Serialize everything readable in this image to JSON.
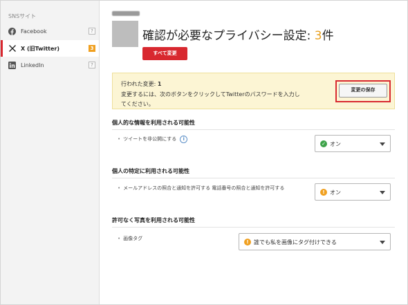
{
  "sidebar": {
    "title": "SNSサイト",
    "items": [
      {
        "label": "Facebook",
        "count": "?"
      },
      {
        "label": "X (旧Twitter)",
        "count": "3"
      },
      {
        "label": "LinkedIn",
        "count": "?"
      }
    ]
  },
  "header": {
    "title_prefix": "確認が必要なプライバシー設定: ",
    "title_count": "3",
    "title_suffix": "件",
    "change_all_label": "すべて変更"
  },
  "notice": {
    "changes_label": "行われた変更: ",
    "changes_count": "1",
    "message": "変更するには、次のボタンをクリックしてTwitterのパスワードを入力してください。",
    "save_label": "変更の保存"
  },
  "sections": [
    {
      "title": "個人的な情報を利用される可能性",
      "setting": "ツイートを非公開にする",
      "value": "オン",
      "status": "ok"
    },
    {
      "title": "個人の特定に利用される可能性",
      "setting": "メールアドレスの照合と通知を許可する 電話番号の照合と通知を許可する",
      "value": "オン",
      "status": "warning"
    },
    {
      "title": "許可なく写真を利用される可能性",
      "setting": "画像タグ",
      "value": "誰でも私を画像にタグ付けできる",
      "status": "warning"
    }
  ],
  "colors": {
    "accent_red": "#d8282f",
    "warning_orange": "#f0a020",
    "ok_green": "#3ea34a",
    "notice_bg": "#fcf5d4"
  }
}
